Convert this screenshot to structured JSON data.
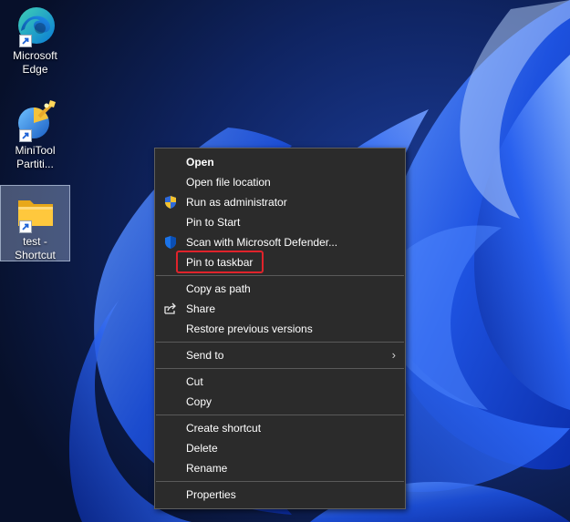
{
  "desktop": {
    "icons": [
      {
        "label_line1": "Microsoft",
        "label_line2": "Edge",
        "icon": "edge-icon"
      },
      {
        "label_line1": "MiniTool",
        "label_line2": "Partiti...",
        "icon": "minitool-icon"
      },
      {
        "label_line1": "test -",
        "label_line2": "Shortcut",
        "icon": "folder-icon"
      }
    ]
  },
  "context_menu": {
    "items": [
      {
        "label": "Open"
      },
      {
        "label": "Open file location"
      },
      {
        "label": "Run as administrator",
        "icon": "shield-icon"
      },
      {
        "label": "Pin to Start"
      },
      {
        "label": "Scan with Microsoft Defender...",
        "icon": "defender-icon"
      },
      {
        "label": "Pin to taskbar"
      },
      {
        "label": "Copy as path"
      },
      {
        "label": "Share",
        "icon": "share-icon"
      },
      {
        "label": "Restore previous versions"
      },
      {
        "label": "Send to",
        "arrow": "›"
      },
      {
        "label": "Cut"
      },
      {
        "label": "Copy"
      },
      {
        "label": "Create shortcut"
      },
      {
        "label": "Delete"
      },
      {
        "label": "Rename"
      },
      {
        "label": "Properties"
      }
    ],
    "highlight_color": "#e0232b"
  }
}
